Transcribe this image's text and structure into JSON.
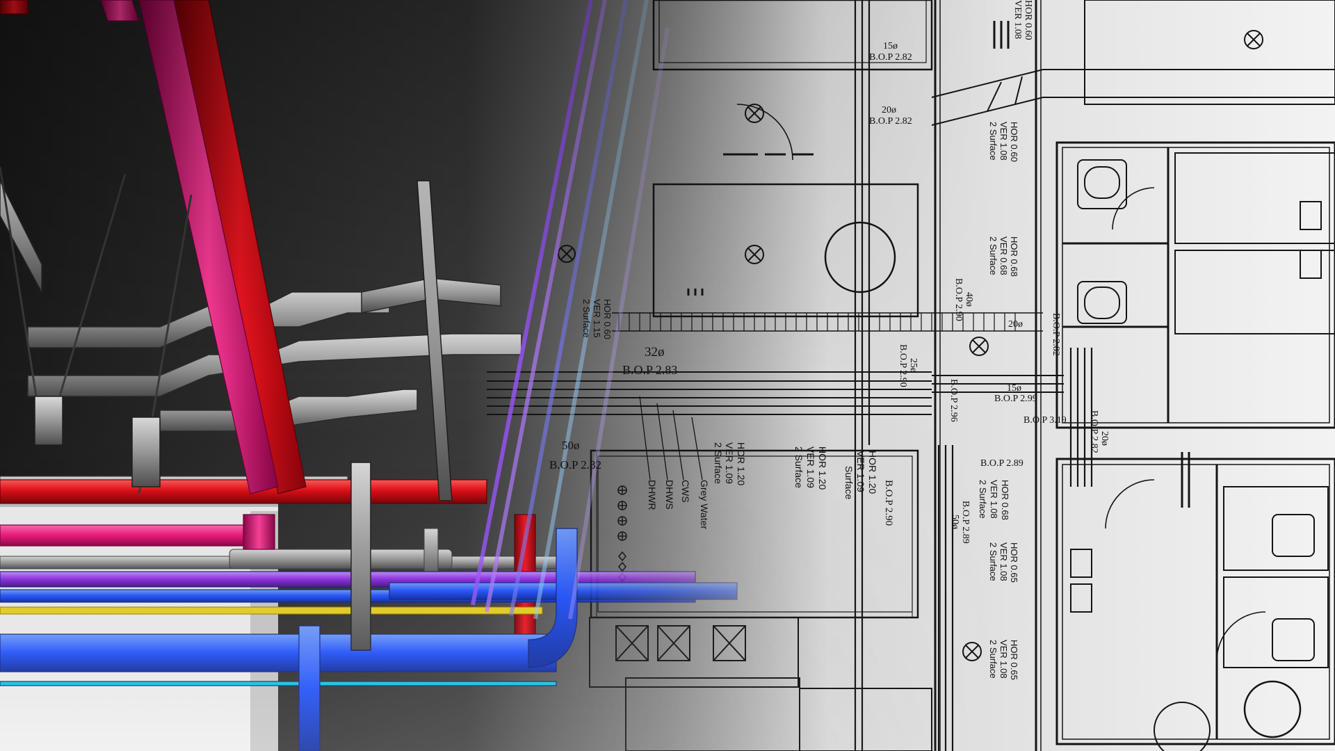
{
  "colors": {
    "background_dark": "#1f1f1f",
    "blueprint_paper": "#f2f2f2",
    "line_ink": "#141414",
    "pipe_red": "#e0101a",
    "pipe_magenta": "#f0147a",
    "pipe_blue": "#1e4fff",
    "pipe_purple": "#8a2be2",
    "pipe_yellow": "#e8d020",
    "pipe_cyan": "#17c3d8",
    "duct_gray": "#9a9a9a"
  },
  "icons": [
    "fan-coil-symbol",
    "duct-crossing-box",
    "valve-symbol"
  ],
  "annotations": {
    "a32": "32ø",
    "bop283": "B.O.P 2.83",
    "a50": "50ø",
    "bop282a": "B.O.P 2.82",
    "dhwr": "DHWR",
    "dhws": "DHWS",
    "cws": "CWS",
    "grey": "Grey Water",
    "hor120a": "HOR 1.20",
    "ver109a": "VER 1.09",
    "surf2a": "2 Surface",
    "hor120b": "HOR 1.20",
    "ver109b": "VER 1.09",
    "surf2b": "2 Surface",
    "hor120c": "HOR 1.20",
    "ver109c": "VER 1.09",
    "surf2c": "Surface",
    "bop290a": "B.O.P 2.90",
    "hor060": "HOR 0.60",
    "ver108a": "VER 1.08",
    "a15": "15ø",
    "bop282b": "B.O.P 2.82",
    "a20": "20ø",
    "bop282c": "B.O.P 2.82",
    "hor060b": "HOR 0.60",
    "ver108b": "VER 1.08",
    "surf2d": "2 Surface",
    "hor068": "HOR 0.68",
    "ver068": "VER 0.68",
    "surf2e": "2 Surface",
    "a40": "40ø",
    "bop290b": "B.O.P 2.90",
    "a25": "25ø",
    "bop290c": "B.O.P 2.90",
    "a20b": "20ø",
    "bop282d": "B.O.P 2.82",
    "a15b": "15ø",
    "bop299": "B.O.P 2.99",
    "bop296": "B.O.P 2.96",
    "bop319": "B.O.P 3.19",
    "bop289": "B.O.P 2.89",
    "a50b": "50ø",
    "hor068b": "HOR 0.68",
    "ver108c": "VER 1.08",
    "surf2f": "2 Surface",
    "hor065": "HOR 0.65",
    "ver108d": "VER 1.08",
    "surf2g": "2 Surface",
    "hor065b": "HOR 0.65",
    "ver108e": "VER 1.08",
    "surf2h": "2 Surface",
    "hor060c": "HOR 0.60",
    "ver115": "VER 1.15",
    "surf2i": "2 Surface",
    "a20c": "20ø",
    "bop282e": "B.O.P 2.82"
  }
}
